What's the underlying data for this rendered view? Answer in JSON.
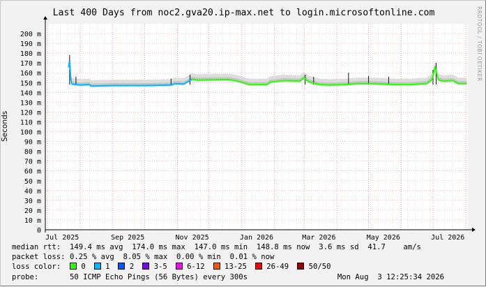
{
  "chart_data": {
    "type": "line",
    "title": "Last 400 Days from noc2.gva20.ip-max.net to login.microsoftonline.com",
    "ylabel": "Seconds",
    "ylim": [
      0,
      0.21
    ],
    "y_ticks": [
      {
        "value": 0,
        "label": "0"
      },
      {
        "value": 0.01,
        "label": "10 m"
      },
      {
        "value": 0.02,
        "label": "20 m"
      },
      {
        "value": 0.03,
        "label": "30 m"
      },
      {
        "value": 0.04,
        "label": "40 m"
      },
      {
        "value": 0.05,
        "label": "50 m"
      },
      {
        "value": 0.06,
        "label": "60 m"
      },
      {
        "value": 0.07,
        "label": "70 m"
      },
      {
        "value": 0.08,
        "label": "80 m"
      },
      {
        "value": 0.09,
        "label": "90 m"
      },
      {
        "value": 0.1,
        "label": "100 m"
      },
      {
        "value": 0.11,
        "label": "110 m"
      },
      {
        "value": 0.12,
        "label": "120 m"
      },
      {
        "value": 0.13,
        "label": "130 m"
      },
      {
        "value": 0.14,
        "label": "140 m"
      },
      {
        "value": 0.15,
        "label": "150 m"
      },
      {
        "value": 0.16,
        "label": "160 m"
      },
      {
        "value": 0.17,
        "label": "170 m"
      },
      {
        "value": 0.18,
        "label": "180 m"
      },
      {
        "value": 0.19,
        "label": "190 m"
      },
      {
        "value": 0.2,
        "label": "200 m"
      }
    ],
    "xlim": [
      "2025-06-29",
      "2026-08-03"
    ],
    "x_ticks": [
      {
        "date": "2025-07-15",
        "label": "Jul 2025"
      },
      {
        "date": "2025-09-15",
        "label": "Sep 2025"
      },
      {
        "date": "2025-11-15",
        "label": "Nov 2025"
      },
      {
        "date": "2026-01-15",
        "label": "Jan 2026"
      },
      {
        "date": "2026-03-15",
        "label": "Mar 2026"
      },
      {
        "date": "2026-05-15",
        "label": "May 2026"
      },
      {
        "date": "2026-07-15",
        "label": "Jul 2026"
      }
    ],
    "grid": true,
    "median_series": [
      {
        "date": "2025-07-21",
        "value": 0.1655,
        "loss": 1
      },
      {
        "date": "2025-07-22",
        "value": 0.172,
        "loss": 1
      },
      {
        "date": "2025-07-23",
        "value": 0.155,
        "loss": 1
      },
      {
        "date": "2025-07-24",
        "value": 0.1485,
        "loss": 1
      },
      {
        "date": "2025-08-01",
        "value": 0.1475,
        "loss": 1
      },
      {
        "date": "2025-08-10",
        "value": 0.148,
        "loss": 1
      },
      {
        "date": "2025-08-11",
        "value": 0.1465,
        "loss": 1
      },
      {
        "date": "2025-09-01",
        "value": 0.147,
        "loss": 1
      },
      {
        "date": "2025-10-01",
        "value": 0.147,
        "loss": 1
      },
      {
        "date": "2025-10-26",
        "value": 0.1475,
        "loss": 1
      },
      {
        "date": "2025-10-30",
        "value": 0.149,
        "loss": 1
      },
      {
        "date": "2025-11-07",
        "value": 0.1485,
        "loss": 1
      },
      {
        "date": "2025-11-15",
        "value": 0.1535,
        "loss": 1
      },
      {
        "date": "2025-11-20",
        "value": 0.1525,
        "loss": 0
      },
      {
        "date": "2025-12-10",
        "value": 0.153,
        "loss": 0
      },
      {
        "date": "2025-12-20",
        "value": 0.153,
        "loss": 0
      },
      {
        "date": "2025-12-28",
        "value": 0.1515,
        "loss": 0
      },
      {
        "date": "2026-01-08",
        "value": 0.148,
        "loss": 0
      },
      {
        "date": "2026-01-25",
        "value": 0.148,
        "loss": 0
      },
      {
        "date": "2026-01-28",
        "value": 0.1505,
        "loss": 0
      },
      {
        "date": "2026-02-10",
        "value": 0.152,
        "loss": 0
      },
      {
        "date": "2026-02-25",
        "value": 0.1515,
        "loss": 0
      },
      {
        "date": "2026-03-01",
        "value": 0.155,
        "loss": 0
      },
      {
        "date": "2026-03-05",
        "value": 0.151,
        "loss": 0
      },
      {
        "date": "2026-03-15",
        "value": 0.148,
        "loss": 0
      },
      {
        "date": "2026-03-25",
        "value": 0.1475,
        "loss": 0
      },
      {
        "date": "2026-04-10",
        "value": 0.148,
        "loss": 0
      },
      {
        "date": "2026-04-20",
        "value": 0.149,
        "loss": 0
      },
      {
        "date": "2026-05-05",
        "value": 0.149,
        "loss": 0
      },
      {
        "date": "2026-05-25",
        "value": 0.148,
        "loss": 0
      },
      {
        "date": "2026-06-10",
        "value": 0.148,
        "loss": 0
      },
      {
        "date": "2026-06-25",
        "value": 0.149,
        "loss": 0
      },
      {
        "date": "2026-06-30",
        "value": 0.153,
        "loss": 0
      },
      {
        "date": "2026-07-03",
        "value": 0.166,
        "loss": 0
      },
      {
        "date": "2026-07-06",
        "value": 0.153,
        "loss": 0
      },
      {
        "date": "2026-07-10",
        "value": 0.1515,
        "loss": 0
      },
      {
        "date": "2026-07-20",
        "value": 0.152,
        "loss": 0
      },
      {
        "date": "2026-07-25",
        "value": 0.149,
        "loss": 0
      },
      {
        "date": "2026-08-02",
        "value": 0.149,
        "loss": 0
      }
    ],
    "spikes": [
      {
        "date": "2025-07-22",
        "value": 0.178
      },
      {
        "date": "2025-07-28",
        "value": 0.156
      },
      {
        "date": "2025-10-26",
        "value": 0.154
      },
      {
        "date": "2025-11-13",
        "value": 0.158
      },
      {
        "date": "2026-03-02",
        "value": 0.158
      },
      {
        "date": "2026-03-10",
        "value": 0.156
      },
      {
        "date": "2026-04-12",
        "value": 0.16
      },
      {
        "date": "2026-05-01",
        "value": 0.157
      },
      {
        "date": "2026-05-20",
        "value": 0.156
      },
      {
        "date": "2026-07-01",
        "value": 0.163
      },
      {
        "date": "2026-07-04",
        "value": 0.17
      }
    ]
  },
  "stats": {
    "median_rtt": {
      "label": "median rtt:",
      "avg": "149.4 ms avg",
      "max": "174.0 ms max",
      "min": "147.0 ms min",
      "now": "148.8 ms now",
      "sd": "3.6 ms sd",
      "ams": "41.7    am/s"
    },
    "packet_loss": {
      "label": "packet loss:",
      "avg": "0.25 % avg",
      "max": "8.05 % max",
      "min": "0.00 % min",
      "now": "0.01 % now"
    },
    "loss_color": {
      "label": "loss color:",
      "items": [
        {
          "label": "0",
          "color": "#26ff00"
        },
        {
          "label": "1",
          "color": "#00b8ff"
        },
        {
          "label": "2",
          "color": "#0059ff"
        },
        {
          "label": "3-5",
          "color": "#7e00ff"
        },
        {
          "label": "6-12",
          "color": "#ff00ff"
        },
        {
          "label": "13-25",
          "color": "#ff5500"
        },
        {
          "label": "26-49",
          "color": "#ff0000"
        },
        {
          "label": "50/50",
          "color": "#a10000"
        }
      ]
    },
    "probe": {
      "label": "probe:",
      "description": "50 ICMP Echo Pings (56 Bytes) every 300s",
      "date": "Mon Aug  3 12:25:34 2026"
    }
  },
  "watermark": "RRDTOOL / TOBI OETIKER"
}
